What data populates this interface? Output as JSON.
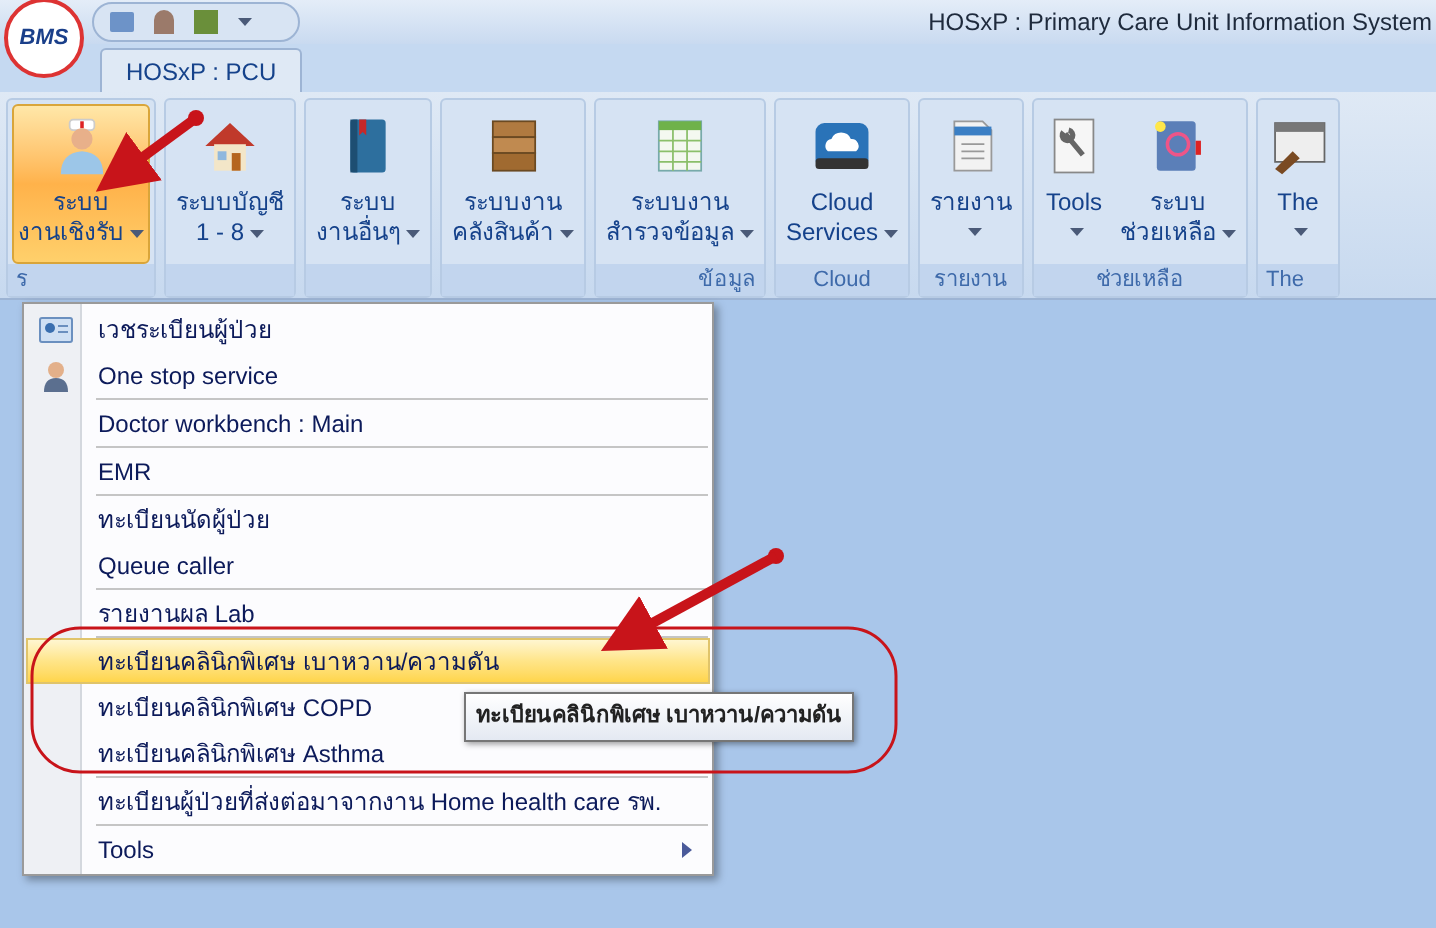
{
  "window": {
    "title": "HOSxP : Primary Care Unit Information System"
  },
  "logo": {
    "text": "BMS"
  },
  "tabs": [
    {
      "label": "HOSxP : PCU",
      "selected": true
    }
  ],
  "ribbon": [
    {
      "label": "ร",
      "buttons": [
        {
          "lines": [
            "ระบบ",
            "งานเชิงรับ"
          ],
          "selected": true
        }
      ]
    },
    {
      "buttons": [
        {
          "lines": [
            "ระบบบัญชี",
            "1 - 8"
          ],
          "selected": false
        }
      ]
    },
    {
      "buttons": [
        {
          "lines": [
            "ระบบ",
            "งานอื่นๆ"
          ],
          "selected": false
        }
      ]
    },
    {
      "buttons": [
        {
          "lines": [
            "ระบบงาน",
            "คลังสินค้า"
          ],
          "selected": false
        }
      ]
    },
    {
      "label": "ข้อมูล",
      "buttons": [
        {
          "lines": [
            "ระบบงาน",
            "สำรวจข้อมูล"
          ],
          "selected": false
        }
      ]
    },
    {
      "label": "Cloud",
      "buttons": [
        {
          "lines": [
            "Cloud",
            "Services"
          ],
          "selected": false
        }
      ]
    },
    {
      "label": "รายงาน",
      "buttons": [
        {
          "lines": [
            "รายงาน"
          ],
          "selected": false
        }
      ]
    },
    {
      "label": "ช่วยเหลือ",
      "buttons": [
        {
          "lines": [
            "Tools"
          ],
          "selected": false
        },
        {
          "lines": [
            "ระบบ",
            "ช่วยเหลือ"
          ],
          "selected": false
        }
      ]
    },
    {
      "label": "The",
      "buttons": [
        {
          "lines": [
            "The"
          ],
          "selected": false
        }
      ]
    }
  ],
  "menu": {
    "items": [
      {
        "label": "เวชระเบียนผู้ป่วย",
        "kind": "command",
        "group_start": false,
        "selected": false
      },
      {
        "label": "One stop service",
        "kind": "command",
        "group_start": false,
        "selected": false
      },
      {
        "label": "Doctor workbench : Main",
        "kind": "command",
        "group_start": true,
        "selected": false
      },
      {
        "label": "EMR",
        "kind": "command",
        "group_start": true,
        "selected": false
      },
      {
        "label": "ทะเบียนนัดผู้ป่วย",
        "kind": "command",
        "group_start": true,
        "selected": false
      },
      {
        "label": "Queue caller",
        "kind": "command",
        "group_start": false,
        "selected": false
      },
      {
        "label": "รายงานผล Lab",
        "kind": "command",
        "group_start": true,
        "selected": false
      },
      {
        "label": "ทะเบียนคลินิกพิเศษ เบาหวาน/ความดัน",
        "kind": "command",
        "group_start": true,
        "selected": true
      },
      {
        "label": "ทะเบียนคลินิกพิเศษ COPD",
        "kind": "command",
        "group_start": false,
        "selected": false
      },
      {
        "label": "ทะเบียนคลินิกพิเศษ Asthma",
        "kind": "command",
        "group_start": false,
        "selected": false
      },
      {
        "label": "ทะเบียนผู้ป่วยที่ส่งต่อมาจากงาน Home health care รพ.",
        "kind": "command",
        "group_start": true,
        "selected": false
      },
      {
        "label": "Tools",
        "kind": "submenu",
        "group_start": true,
        "selected": false
      }
    ]
  },
  "tooltip": {
    "text": "ทะเบียนคลินิกพิเศษ เบาหวาน/ความดัน"
  }
}
